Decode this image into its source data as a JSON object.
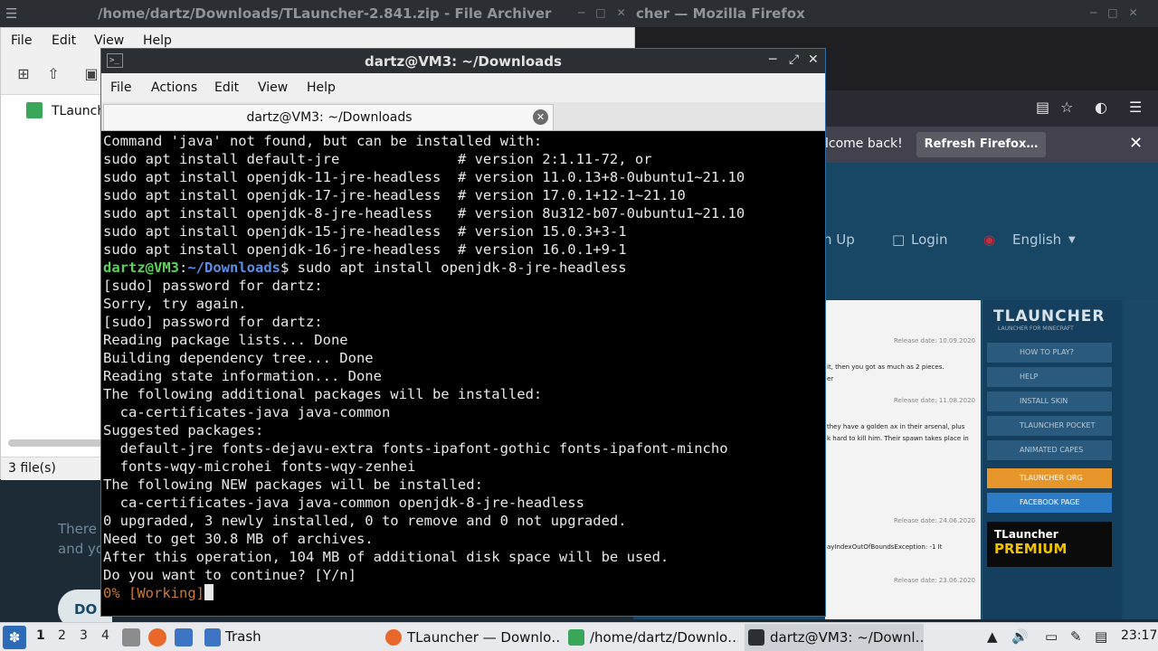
{
  "desktop": {
    "archiver_title": "/home/dartz/Downloads/TLauncher-2.841.zip - File Archiver",
    "firefox_title_partial": "cher — Mozilla Firefox",
    "text_line1": "There",
    "text_line2": "and yo",
    "button_partial": "DO"
  },
  "firefox": {
    "notice_message": "lcome back!",
    "refresh_button": "Refresh Firefox…",
    "nav": {
      "signup_partial": "n Up",
      "login": "Login",
      "language": "English"
    },
    "content": {
      "release1": "Release date: 10.09.2020",
      "text1": "it, then you got as much as 2 pieces.",
      "text1b": "er",
      "release2": "Release date: 11.08.2020",
      "text2": "they have a golden ax in their arsenal, plus",
      "text2b": "k hard to kill him. Their spawn takes place in",
      "release3": "Release date: 24.06.2020",
      "text3": "ayIndexOutOfBoundsException: -1  It",
      "release4": "Release date: 23.06.2020"
    },
    "sidebar": {
      "brand": "TLAUNCHER",
      "subtitle": "LAUNCHER FOR MINECRAFT",
      "items": [
        "HOW TO PLAY?",
        "HELP",
        "INSTALL SKIN",
        "TLAUNCHER POCKET",
        "ANIMATED CAPES",
        "TLAUNCHER ORG",
        "FACEBOOK PAGE"
      ],
      "premium_line1": "TLauncher",
      "premium_line2": "PREMIUM"
    }
  },
  "archiver": {
    "menu": [
      "File",
      "Edit",
      "View",
      "Help"
    ],
    "tree_item": "TLaunch",
    "status": "3 file(s)"
  },
  "terminal": {
    "title": "dartz@VM3: ~/Downloads",
    "menu": [
      "File",
      "Actions",
      "Edit",
      "View",
      "Help"
    ],
    "tab_label": "dartz@VM3: ~/Downloads",
    "prompt_user": "dartz@VM3",
    "prompt_path": "~/Downloads",
    "command": "$ sudo apt install openjdk-8-jre-headless",
    "lines_before": [
      "Command 'java' not found, but can be installed with:",
      "sudo apt install default-jre              # version 2:1.11-72, or",
      "sudo apt install openjdk-11-jre-headless  # version 11.0.13+8-0ubuntu1~21.10",
      "sudo apt install openjdk-17-jre-headless  # version 17.0.1+12-1~21.10",
      "sudo apt install openjdk-8-jre-headless   # version 8u312-b07-0ubuntu1~21.10",
      "sudo apt install openjdk-15-jre-headless  # version 15.0.3+3-1",
      "sudo apt install openjdk-16-jre-headless  # version 16.0.1+9-1"
    ],
    "lines_after": [
      "[sudo] password for dartz:",
      "Sorry, try again.",
      "[sudo] password for dartz:",
      "Reading package lists... Done",
      "Building dependency tree... Done",
      "Reading state information... Done",
      "The following additional packages will be installed:",
      "  ca-certificates-java java-common",
      "Suggested packages:",
      "  default-jre fonts-dejavu-extra fonts-ipafont-gothic fonts-ipafont-mincho",
      "  fonts-wqy-microhei fonts-wqy-zenhei",
      "The following NEW packages will be installed:",
      "  ca-certificates-java java-common openjdk-8-jre-headless",
      "0 upgraded, 3 newly installed, 0 to remove and 0 not upgraded.",
      "Need to get 30.8 MB of archives.",
      "After this operation, 104 MB of additional disk space will be used.",
      "Do you want to continue? [Y/n]"
    ],
    "progress_line": "0% [Working]"
  },
  "taskbar": {
    "workspaces": [
      "1",
      "2",
      "3",
      "4"
    ],
    "trash_label": "Trash",
    "tasks": [
      "TLauncher — Downlo…",
      "/home/dartz/Downlo…",
      "dartz@VM3: ~/Downl…"
    ],
    "clock": "23:17"
  }
}
